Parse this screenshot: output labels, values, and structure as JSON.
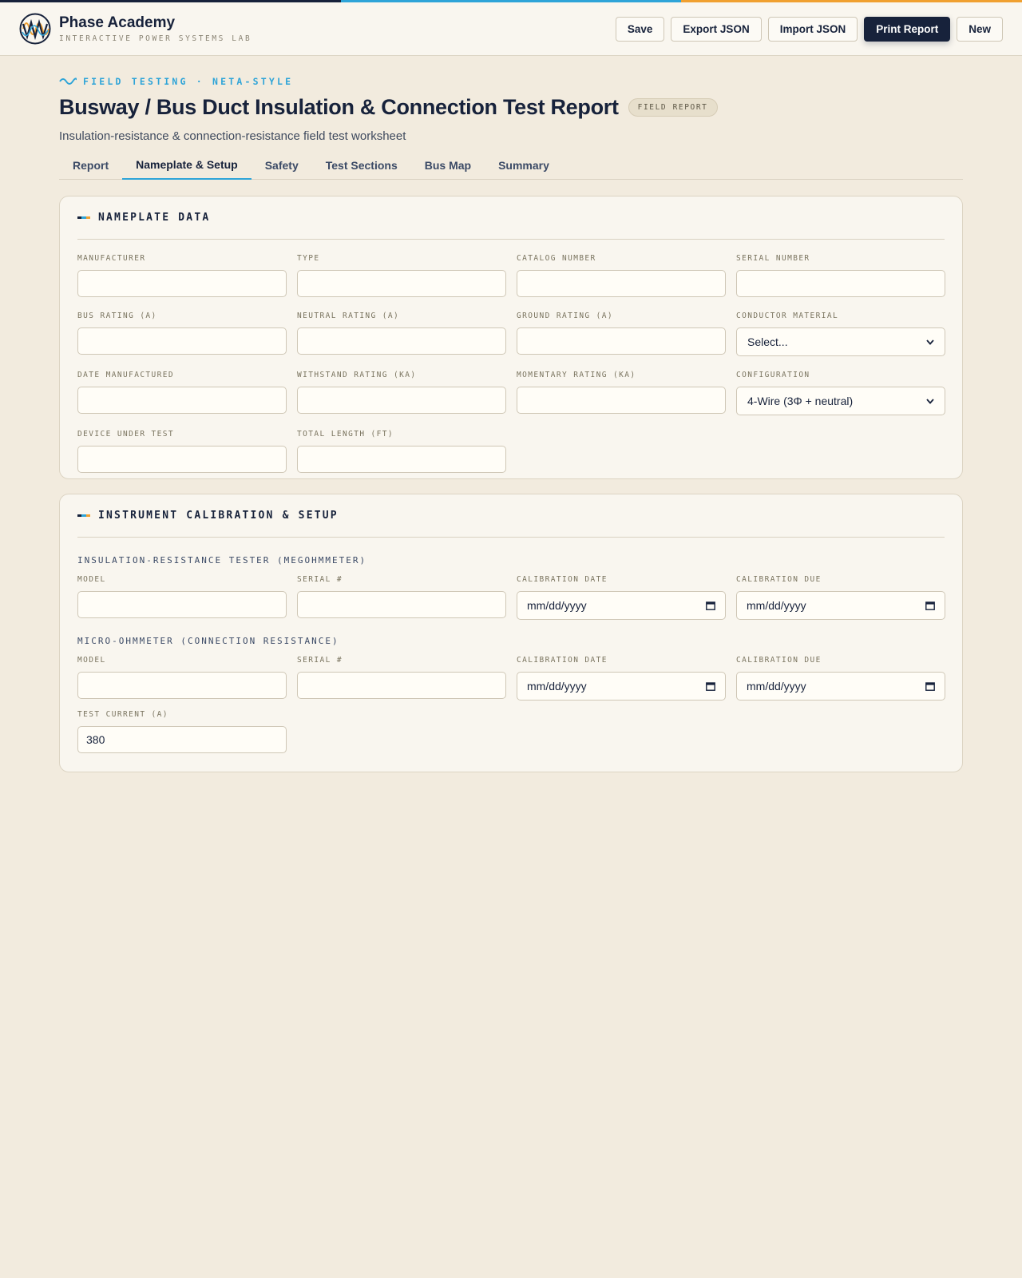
{
  "colors": {
    "stripe": [
      "#17223b",
      "#2ea4d8",
      "#f0a030"
    ],
    "accent": "#2ea4d8",
    "ink": "#17223b",
    "card_mark": [
      "#17223b",
      "#2ea4d8",
      "#f0a030"
    ]
  },
  "header": {
    "brand_title": "Phase Academy",
    "brand_subtitle": "INTERACTIVE POWER SYSTEMS LAB",
    "actions": [
      "Save",
      "Export JSON",
      "Import JSON",
      "Print Report",
      "New"
    ]
  },
  "page": {
    "eyebrow": "FIELD TESTING · NETA-STYLE",
    "title": "Busway / Bus Duct Insulation & Connection Test Report",
    "badge": "FIELD REPORT",
    "subtitle": "Insulation-resistance & connection-resistance field test worksheet"
  },
  "tabs": [
    "Report",
    "Nameplate & Setup",
    "Safety",
    "Test Sections",
    "Bus Map",
    "Summary"
  ],
  "nameplate": {
    "title": "NAMEPLATE DATA",
    "fields": [
      {
        "label": "MANUFACTURER",
        "value": ""
      },
      {
        "label": "TYPE",
        "value": ""
      },
      {
        "label": "CATALOG NUMBER",
        "value": ""
      },
      {
        "label": "SERIAL NUMBER",
        "value": ""
      },
      {
        "label": "BUS RATING (A)",
        "value": ""
      },
      {
        "label": "NEUTRAL RATING (A)",
        "value": ""
      },
      {
        "label": "GROUND RATING (A)",
        "value": ""
      },
      {
        "label": "CONDUCTOR MATERIAL",
        "value": "Select..."
      },
      {
        "label": "DATE MANUFACTURED",
        "value": ""
      },
      {
        "label": "WITHSTAND RATING (KA)",
        "value": ""
      },
      {
        "label": "MOMENTARY RATING (KA)",
        "value": ""
      },
      {
        "label": "CONFIGURATION",
        "value": "4-Wire (3Φ + neutral)"
      },
      {
        "label": "DEVICE UNDER TEST",
        "value": ""
      },
      {
        "label": "TOTAL LENGTH (FT)",
        "value": ""
      }
    ]
  },
  "instruments": {
    "title": "INSTRUMENT CALIBRATION & SETUP",
    "megohmmeter": {
      "heading": "INSULATION-RESISTANCE TESTER (MEGOHMMETER)",
      "fields": [
        {
          "label": "MODEL",
          "value": ""
        },
        {
          "label": "SERIAL #",
          "value": ""
        },
        {
          "label": "CALIBRATION DATE",
          "value": "mm/dd/yyyy"
        },
        {
          "label": "CALIBRATION DUE",
          "value": "mm/dd/yyyy"
        }
      ]
    },
    "microohmmeter": {
      "heading": "MICRO-OHMMETER (CONNECTION RESISTANCE)",
      "fields": [
        {
          "label": "MODEL",
          "value": ""
        },
        {
          "label": "SERIAL #",
          "value": ""
        },
        {
          "label": "CALIBRATION DATE",
          "value": "mm/dd/yyyy"
        },
        {
          "label": "CALIBRATION DUE",
          "value": "mm/dd/yyyy"
        },
        {
          "label": "TEST CURRENT (A)",
          "value": "380"
        }
      ]
    }
  }
}
